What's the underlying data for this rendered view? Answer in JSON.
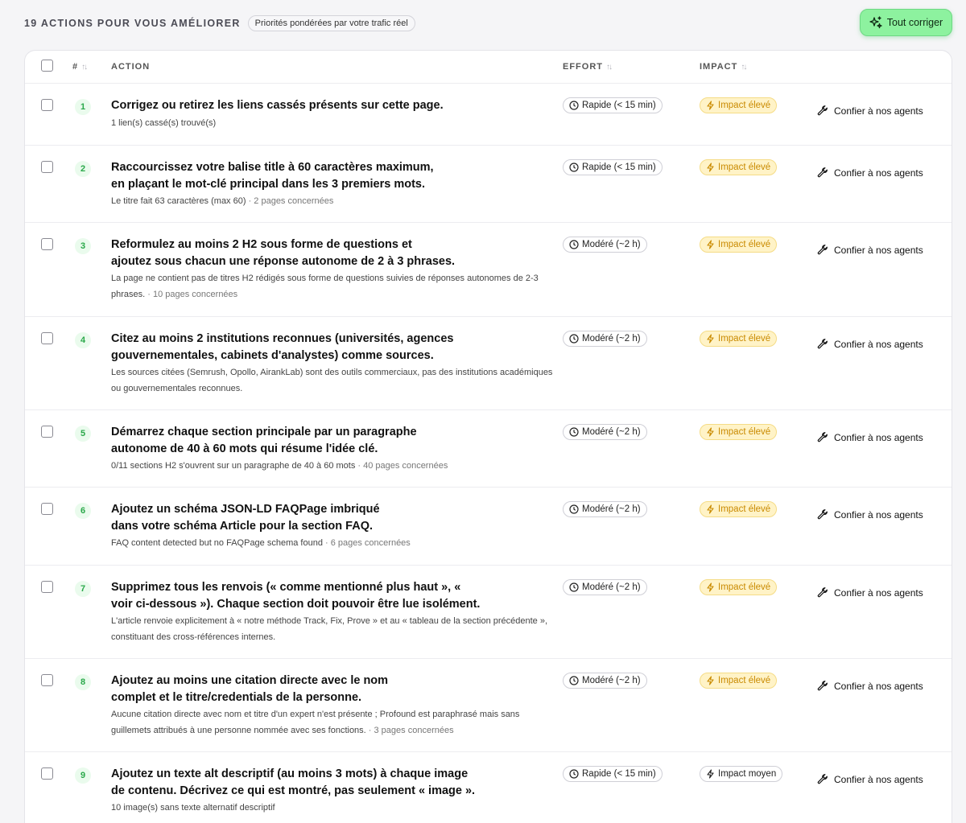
{
  "header": {
    "title": "19 ACTIONS POUR VOUS AMÉLIORER",
    "subtitle_badge": "Priorités pondérées par votre trafic réel",
    "fix_all_label": "Tout corriger"
  },
  "table": {
    "columns": {
      "number": "#",
      "action": "ACTION",
      "effort": "EFFORT",
      "impact": "IMPACT"
    },
    "delegate_label": "Confier à nos agents",
    "rows": [
      {
        "number": "1",
        "title": "Corrigez ou retirez les liens cassés présents sur cette page.",
        "detail": "1 lien(s) cassé(s) trouvé(s)",
        "pages": "",
        "effort": "Rapide (< 15 min)",
        "impact": "Impact élevé",
        "impact_level": "high"
      },
      {
        "number": "2",
        "title": "Raccourcissez votre balise title à 60 caractères maximum,\nen plaçant le mot-clé principal dans les 3 premiers mots.",
        "detail": "Le titre fait 63 caractères (max 60)",
        "pages": " · 2 pages concernées",
        "effort": "Rapide (< 15 min)",
        "impact": "Impact élevé",
        "impact_level": "high"
      },
      {
        "number": "3",
        "title": "Reformulez au moins 2 H2 sous forme de questions et\najoutez sous chacun une réponse autonome de 2 à 3 phrases.",
        "detail": "La page ne contient pas de titres H2 rédigés sous forme de questions suivies de réponses autonomes de 2-3 phrases.",
        "pages": " · 10 pages concernées",
        "effort": "Modéré (~2 h)",
        "impact": "Impact élevé",
        "impact_level": "high"
      },
      {
        "number": "4",
        "title": "Citez au moins 2 institutions reconnues (universités, agences\ngouvernementales, cabinets d'analystes) comme sources.",
        "detail": "Les sources citées (Semrush, Opollo, AirankLab) sont des outils commerciaux, pas des institutions académiques ou gouvernementales reconnues.",
        "pages": "",
        "effort": "Modéré (~2 h)",
        "impact": "Impact élevé",
        "impact_level": "high"
      },
      {
        "number": "5",
        "title": "Démarrez chaque section principale par un paragraphe\nautonome de 40 à 60 mots qui résume l'idée clé.",
        "detail": "0/11 sections H2 s'ouvrent sur un paragraphe de 40 à 60 mots",
        "pages": " · 40 pages concernées",
        "effort": "Modéré (~2 h)",
        "impact": "Impact élevé",
        "impact_level": "high"
      },
      {
        "number": "6",
        "title": "Ajoutez un schéma JSON-LD FAQPage imbriqué\ndans votre schéma Article pour la section FAQ.",
        "detail": "FAQ content detected but no FAQPage schema found",
        "pages": " · 6 pages concernées",
        "effort": "Modéré (~2 h)",
        "impact": "Impact élevé",
        "impact_level": "high"
      },
      {
        "number": "7",
        "title": "Supprimez tous les renvois (« comme mentionné plus haut », «\nvoir ci-dessous »). Chaque section doit pouvoir être lue isolément.",
        "detail": "L'article renvoie explicitement à « notre méthode Track, Fix, Prove » et au « tableau de la section précédente », constituant des cross-références internes.",
        "pages": "",
        "effort": "Modéré (~2 h)",
        "impact": "Impact élevé",
        "impact_level": "high"
      },
      {
        "number": "8",
        "title": "Ajoutez au moins une citation directe avec le nom\ncomplet et le titre/credentials de la personne.",
        "detail": "Aucune citation directe avec nom et titre d'un expert n'est présente ; Profound est paraphrasé mais sans guillemets attribués à une personne nommée avec ses fonctions.",
        "pages": " · 3 pages concernées",
        "effort": "Modéré (~2 h)",
        "impact": "Impact élevé",
        "impact_level": "high"
      },
      {
        "number": "9",
        "title": "Ajoutez un texte alt descriptif (au moins 3 mots) à chaque image\nde contenu. Décrivez ce qui est montré, pas seulement « image ».",
        "detail": "10 image(s) sans texte alternatif descriptif",
        "pages": "",
        "effort": "Rapide (< 15 min)",
        "impact": "Impact moyen",
        "impact_level": "medium"
      }
    ]
  },
  "icons": {
    "fix_all": "sparkles-icon",
    "effort": "clock-icon",
    "impact": "lightning-bolt-icon",
    "delegate": "wrench-icon",
    "sort": "sort-arrows-icon"
  },
  "colors": {
    "accent_green": "#8df29f",
    "rank_green": "#2aa84a",
    "impact_high_bg": "#fff3c7",
    "impact_high_text": "#c98a00"
  }
}
